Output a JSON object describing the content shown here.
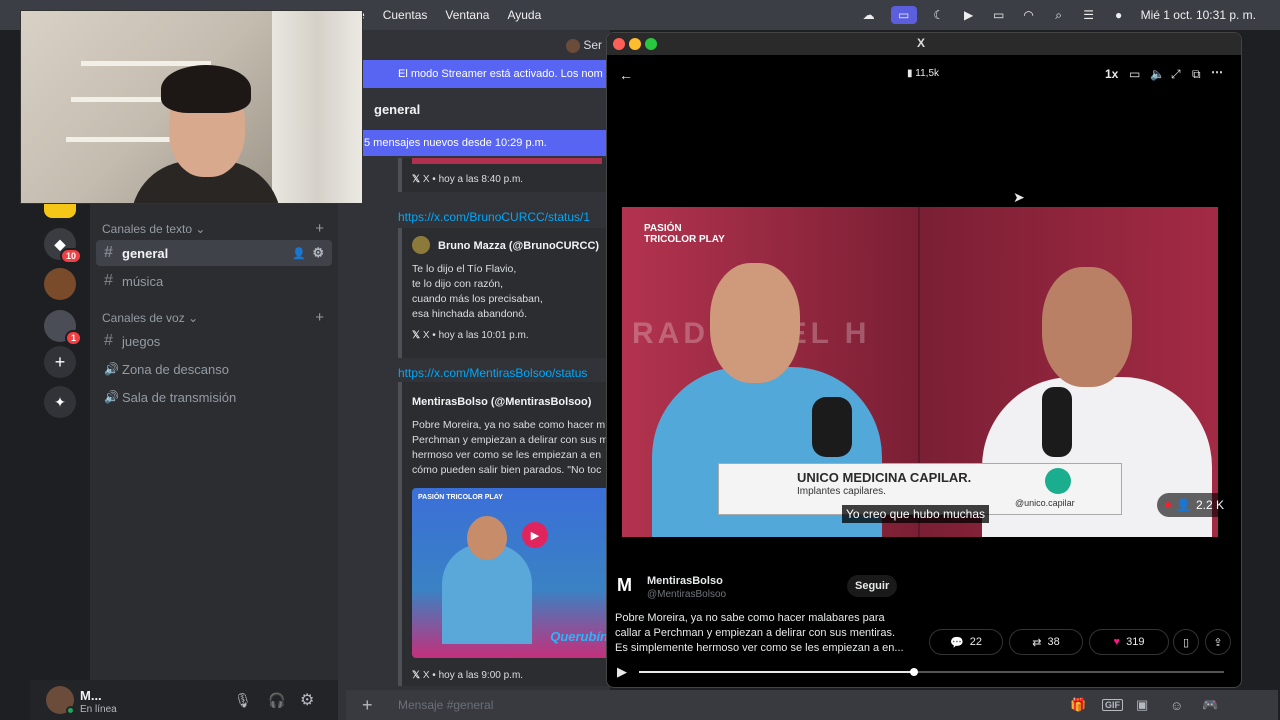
{
  "menubar": {
    "items": [
      "Cuentas",
      "Ventana",
      "Ayuda"
    ],
    "partial_left": "e",
    "datetime": "Mié 1 oct. 10:31 p. m."
  },
  "server": {
    "header_partial": "Ser",
    "streamer_banner": "El modo Streamer está activado. Los nom",
    "channel_header": "general",
    "new_messages": "5 mensajes nuevos desde 10:29 p.m.",
    "badges": [
      "10",
      "1"
    ]
  },
  "sidebar": {
    "text_category": "Canales de texto",
    "text_channels": [
      "general",
      "música"
    ],
    "voice_category": "Canales de voz",
    "voice_channels": [
      "juegos",
      "Zona de descanso",
      "Sala de transmisión"
    ]
  },
  "user": {
    "name": "M...",
    "status": "En línea"
  },
  "chat": {
    "embed1_footer": "X • hoy a las 8:40 p.m.",
    "link2": "https://x.com/BrunoCURCC/status/1",
    "embed2_author": "Bruno Mazza (@BrunoCURCC)",
    "embed2_text": "Te lo dijo el Tío Flavio,\nte lo dijo con razón,\ncuando más los precisaban,\nesa hinchada abandonó.",
    "embed2_footer": "X • hoy a las 10:01 p.m.",
    "link3": "https://x.com/MentirasBolsoo/status",
    "embed3_author": "MentirasBolso (@MentirasBolsoo)",
    "embed3_text": "Pobre Moreira, ya no sabe como hacer m\nPerchman y empiezan a delirar con sus m\nhermoso ver como se les empiezan a en\ncómo pueden salir bien parados. \"No toc",
    "embed3_footer": "X • hoy a las 9:00 p.m.",
    "thumb_brand": "PASIÓN TRICOLOR PLAY",
    "thumb_caption": "Querubín",
    "composer_placeholder": "Mensaje #general"
  },
  "player": {
    "title": "X",
    "views": "11,5k",
    "speed": "1x",
    "video_brand": "PASIÓN TRICOLOR PLAY",
    "bg_text": "RADIO DEL H",
    "ad_title": "UNICO MEDICINA CAPILAR.",
    "ad_sub": "Implantes capilares.",
    "ad_handle": "@unico.capilar",
    "viewers": "2.2 K",
    "subtitle": "Yo creo que hubo muchas",
    "author_name": "MentirasBolso",
    "author_handle": "@MentirasBolsoo",
    "avatar_letter": "M",
    "follow_label": "Seguir",
    "post_text": "Pobre Moreira, ya no sabe como hacer malabares para\ncallar a Perchman y empiezan a delirar con sus mentiras.\nEs simplemente hermoso ver como se les empiezan a en...",
    "replies": "22",
    "reposts": "38",
    "likes": "319",
    "progress": 0.47,
    "like_color": "#f91880"
  }
}
